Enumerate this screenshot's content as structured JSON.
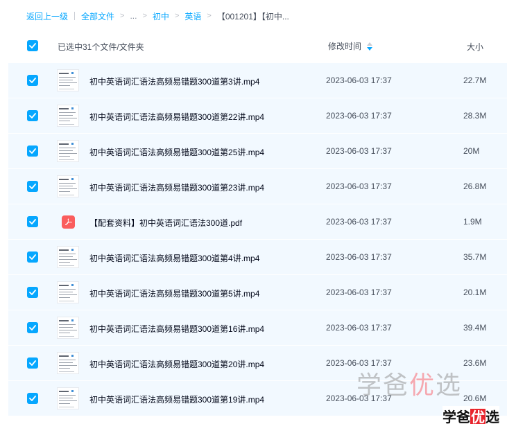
{
  "breadcrumb": {
    "back": "返回上一级",
    "all_files": "全部文件",
    "ellipsis": "...",
    "level1": "初中",
    "level2": "英语",
    "current": "【001201】【初中..."
  },
  "header": {
    "selection_text": "已选中31个文件/文件夹",
    "col_modified": "修改时间",
    "col_size": "大小"
  },
  "files": [
    {
      "name": "初中英语词汇语法高频易错题300道第3讲.mp4",
      "time": "2023-06-03 17:37",
      "size": "22.7M",
      "type": "video"
    },
    {
      "name": "初中英语词汇语法高频易错题300道第22讲.mp4",
      "time": "2023-06-03 17:37",
      "size": "28.3M",
      "type": "video"
    },
    {
      "name": "初中英语词汇语法高频易错题300道第25讲.mp4",
      "time": "2023-06-03 17:37",
      "size": "20M",
      "type": "video"
    },
    {
      "name": "初中英语词汇语法高频易错题300道第23讲.mp4",
      "time": "2023-06-03 17:37",
      "size": "26.8M",
      "type": "video"
    },
    {
      "name": "【配套资料】初中英语词汇语法300道.pdf",
      "time": "2023-06-03 17:37",
      "size": "1.9M",
      "type": "pdf"
    },
    {
      "name": "初中英语词汇语法高频易错题300道第4讲.mp4",
      "time": "2023-06-03 17:37",
      "size": "35.7M",
      "type": "video"
    },
    {
      "name": "初中英语词汇语法高频易错题300道第5讲.mp4",
      "time": "2023-06-03 17:37",
      "size": "20.1M",
      "type": "video"
    },
    {
      "name": "初中英语词汇语法高频易错题300道第16讲.mp4",
      "time": "2023-06-03 17:37",
      "size": "39.4M",
      "type": "video"
    },
    {
      "name": "初中英语词汇语法高频易错题300道第20讲.mp4",
      "time": "2023-06-03 17:37",
      "size": "23.6M",
      "type": "video"
    },
    {
      "name": "初中英语词汇语法高频易错题300道第19讲.mp4",
      "time": "2023-06-03 17:37",
      "size": "20.6M",
      "type": "video"
    }
  ],
  "watermark": {
    "big_part1": "学爸",
    "big_part2": "优",
    "big_part3": "选",
    "small_part1": "学爸",
    "small_part2": "优",
    "small_part3": "选"
  },
  "colors": {
    "accent": "#06a7ff",
    "row_selected_bg": "#f2f9ff",
    "pdf_red": "#fa5d5d"
  }
}
